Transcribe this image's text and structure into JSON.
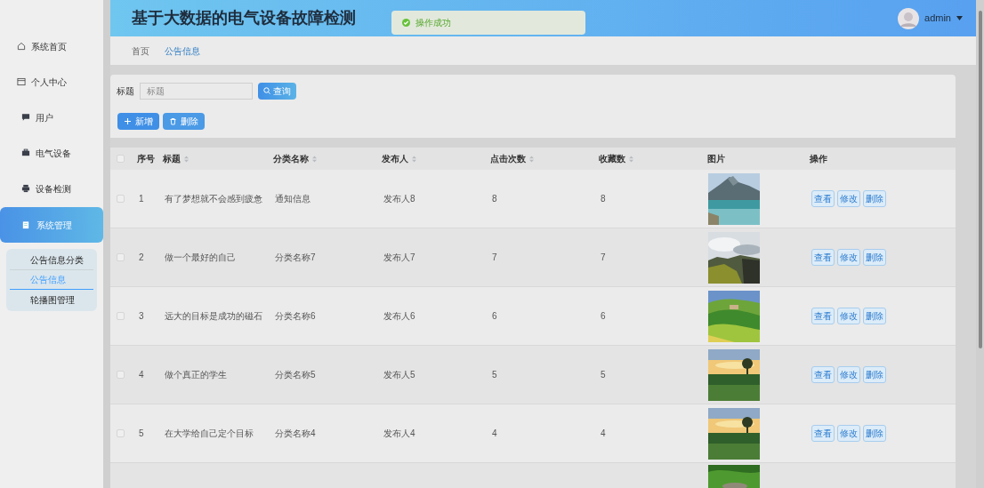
{
  "header": {
    "title": "基于大数据的电气设备故障检测",
    "toast": "操作成功",
    "user": "admin"
  },
  "sidebar": {
    "items": [
      {
        "label": "系统首页",
        "selected": false
      },
      {
        "label": "个人中心",
        "selected": false
      },
      {
        "label": "用户",
        "selected": false
      },
      {
        "label": "电气设备",
        "selected": false
      },
      {
        "label": "设备检测",
        "selected": false
      },
      {
        "label": "系统管理",
        "selected": true,
        "children": [
          {
            "label": "公告信息分类",
            "selected": false
          },
          {
            "label": "公告信息",
            "selected": true
          },
          {
            "label": "轮播图管理",
            "selected": false
          }
        ]
      }
    ]
  },
  "breadcrumb": [
    {
      "label": "首页",
      "selected": false
    },
    {
      "label": "公告信息",
      "selected": true
    }
  ],
  "search": {
    "label": "标题",
    "placeholder": "标题",
    "button": "查询"
  },
  "actions": [
    {
      "label": "新增"
    },
    {
      "label": "删除"
    }
  ],
  "table": {
    "all_checked": false,
    "columns": [
      {
        "label": "序号",
        "sortable": false
      },
      {
        "label": "标题",
        "sortable": true
      },
      {
        "label": "分类名称",
        "sortable": true
      },
      {
        "label": "发布人",
        "sortable": true
      },
      {
        "label": "点击次数",
        "sortable": true
      },
      {
        "label": "收藏数",
        "sortable": true
      },
      {
        "label": "图片",
        "sortable": false
      },
      {
        "label": "操作",
        "sortable": false
      }
    ],
    "rows": [
      {
        "kind": "full",
        "checked": false,
        "no": "1",
        "title": "有了梦想就不会感到疲惫",
        "category": "通知信息",
        "publisher": "发布人8",
        "clicks": "8",
        "favorites": "8",
        "buttons": [
          "查看",
          "修改",
          "删除"
        ]
      },
      {
        "kind": "full",
        "checked": false,
        "no": "2",
        "title": "做一个最好的自己",
        "category": "分类名称7",
        "publisher": "发布人7",
        "clicks": "7",
        "favorites": "7",
        "buttons": [
          "查看",
          "修改",
          "删除"
        ]
      },
      {
        "kind": "full",
        "checked": false,
        "no": "3",
        "title": "远大的目标是成功的磁石",
        "category": "分类名称6",
        "publisher": "发布人6",
        "clicks": "6",
        "favorites": "6",
        "buttons": [
          "查看",
          "修改",
          "删除"
        ]
      },
      {
        "kind": "full",
        "checked": false,
        "no": "4",
        "title": "做个真正的学生",
        "category": "分类名称5",
        "publisher": "发布人5",
        "clicks": "5",
        "favorites": "5",
        "buttons": [
          "查看",
          "修改",
          "删除"
        ]
      },
      {
        "kind": "full",
        "checked": false,
        "no": "5",
        "title": "在大学给自己定个目标",
        "category": "分类名称4",
        "publisher": "发布人4",
        "clicks": "4",
        "favorites": "4",
        "buttons": [
          "查看",
          "修改",
          "删除"
        ]
      },
      {
        "kind": "partial"
      }
    ]
  }
}
